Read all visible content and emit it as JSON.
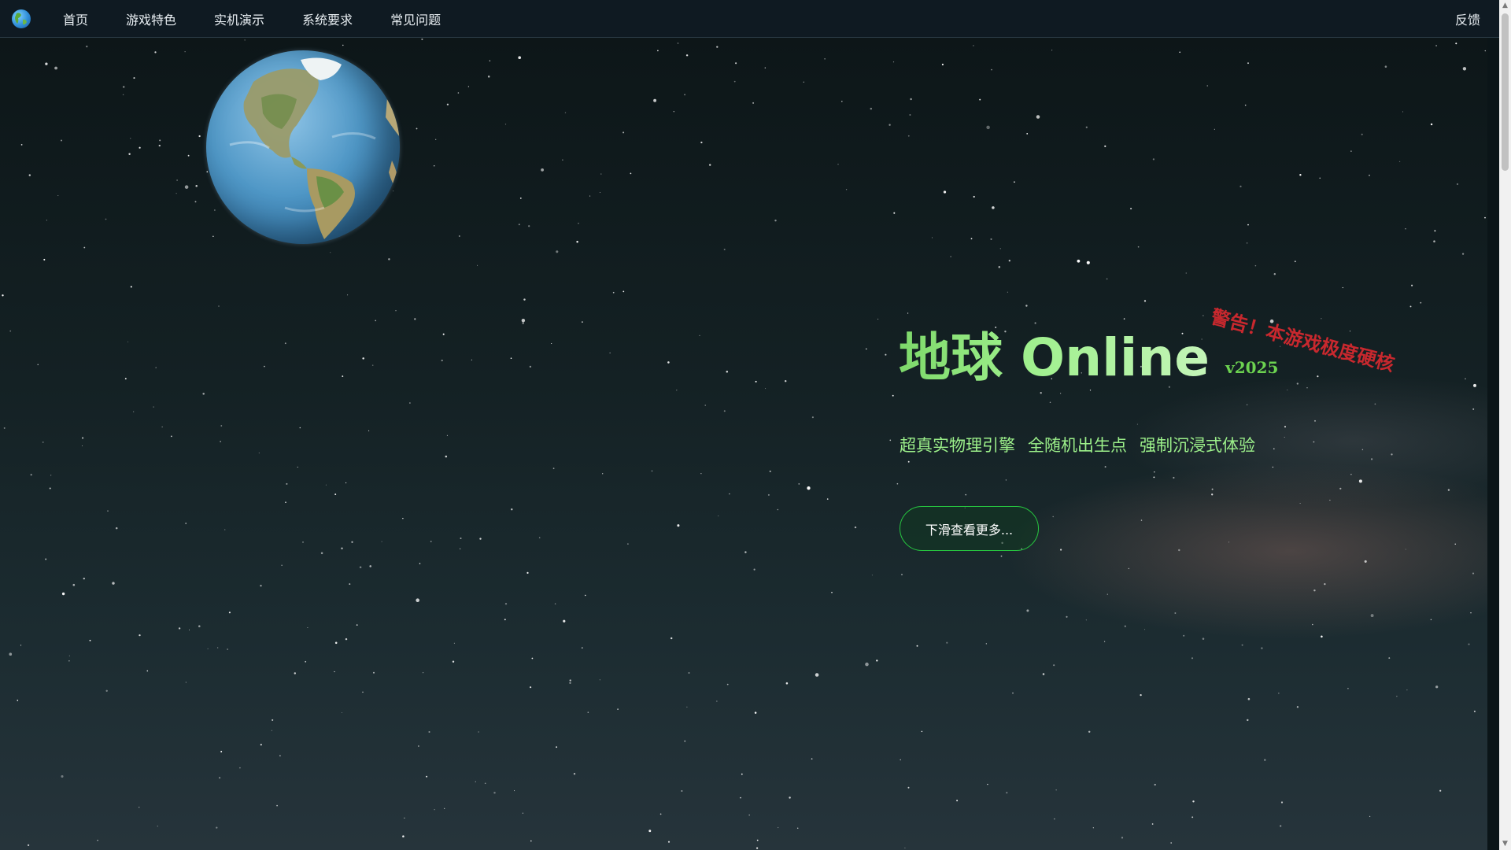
{
  "nav": {
    "logo_icon": "earth-globe-icon",
    "links": [
      {
        "label": "首页"
      },
      {
        "label": "游戏特色"
      },
      {
        "label": "实机演示"
      },
      {
        "label": "系统要求"
      },
      {
        "label": "常见问题"
      }
    ],
    "feedback_label": "反馈"
  },
  "hero": {
    "globe_icon": "earth-globe",
    "title": "地球 Online",
    "version": "v2025",
    "warning": "警告！本游戏极度硬核",
    "taglines": [
      "超真实物理引擎",
      "全随机出生点",
      "强制沉浸式体验"
    ],
    "cta_label": "下滑查看更多..."
  },
  "colors": {
    "nav_bg": "#0f1a22",
    "title_green": "#9ef08c",
    "version_green": "#6cd250",
    "warning_red": "#c8282e",
    "cta_border": "#27c840"
  }
}
